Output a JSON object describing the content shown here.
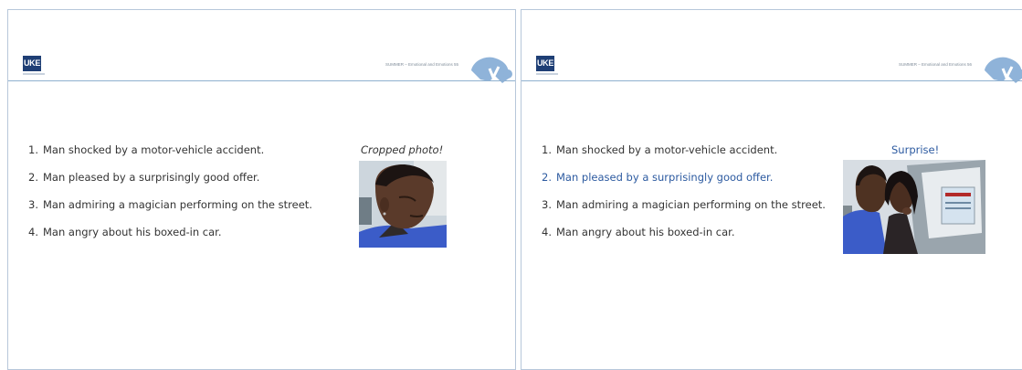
{
  "slides": [
    {
      "logo_text": "UKE",
      "header_text": "SUMMER – Emotional and Emotions    55",
      "items": [
        {
          "num": "1.",
          "text": "Man shocked by a motor-vehicle accident."
        },
        {
          "num": "2.",
          "text": "Man pleased by a surprisingly good offer."
        },
        {
          "num": "3.",
          "text": "Man admiring a magician performing on the street."
        },
        {
          "num": "4.",
          "text": "Man angry about his boxed-in car."
        }
      ],
      "caption": "Cropped photo!"
    },
    {
      "logo_text": "UKE",
      "header_text": "SUMMER – Emotional and Emotions    56",
      "items": [
        {
          "num": "1.",
          "text": "Man shocked by a motor-vehicle accident."
        },
        {
          "num": "2.",
          "text": "Man pleased by a surprisingly good offer.",
          "highlight": true
        },
        {
          "num": "3.",
          "text": "Man admiring a magician performing on the street."
        },
        {
          "num": "4.",
          "text": "Man angry about his boxed-in car."
        }
      ],
      "caption": "Surprise!"
    }
  ],
  "colors": {
    "logo": "#1f3f75",
    "highlight": "#2c5aa0",
    "border": "#b7c7da",
    "rule": "#8fb0cf",
    "mark": "#8fb3d9"
  }
}
